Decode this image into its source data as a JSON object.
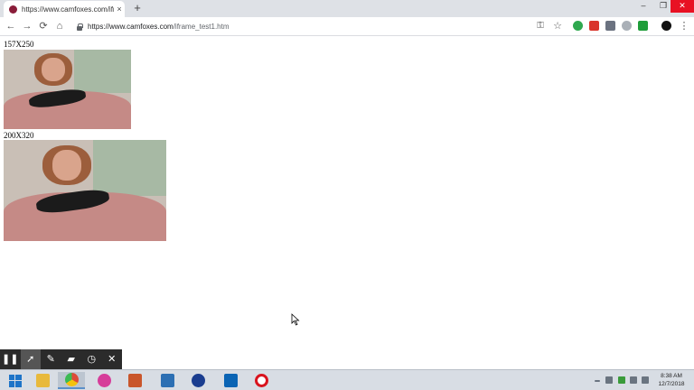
{
  "browser": {
    "tab": {
      "title": "https://www.camfoxes.com/ifram",
      "close": "×"
    },
    "new_tab": "+",
    "window_controls": {
      "minimize": "–",
      "maximize": "❐",
      "close": "✕"
    },
    "nav": {
      "back": "←",
      "forward": "→",
      "reload": "⟳",
      "home": "⌂"
    },
    "address": {
      "url_host": "https://www.camfoxes.com",
      "url_path": "/iframe_test1.htm"
    }
  },
  "page": {
    "frame1_label": "157X250",
    "frame2_label": "200X320"
  },
  "annotation_toolbar": {
    "tools": [
      {
        "name": "pause",
        "glyph": "❚❚"
      },
      {
        "name": "pointer",
        "glyph": "➚"
      },
      {
        "name": "pen",
        "glyph": "✎"
      },
      {
        "name": "eraser",
        "glyph": "▰"
      },
      {
        "name": "timer",
        "glyph": "◷"
      },
      {
        "name": "close",
        "glyph": "✕"
      }
    ]
  },
  "taskbar": {
    "apps": [
      {
        "name": "start",
        "color": "#1e74c8"
      },
      {
        "name": "file-explorer",
        "color": "#e8b93c"
      },
      {
        "name": "chrome",
        "color": "#dd4b39"
      },
      {
        "name": "app-pink",
        "color": "#d63d9a"
      },
      {
        "name": "app-tools",
        "color": "#c9562b"
      },
      {
        "name": "app-shield",
        "color": "#2c6fb3"
      },
      {
        "name": "app-edge",
        "color": "#1a3d8f"
      },
      {
        "name": "outlook",
        "color": "#0a64b4"
      },
      {
        "name": "opera",
        "color": "#d9141e"
      }
    ],
    "clock": {
      "time": "8:38 AM",
      "date": "12/7/2018"
    }
  },
  "colors": {
    "accent": "#1a73e8",
    "close_red": "#e81123"
  }
}
